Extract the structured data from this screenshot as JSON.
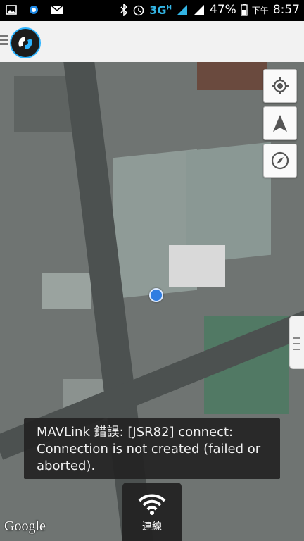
{
  "status_bar": {
    "network": "3G",
    "signal_sup": "H",
    "battery_percent": "47%",
    "ampm": "下午",
    "time": "8:57",
    "icons": [
      "gallery-icon",
      "app-icon",
      "mail-icon",
      "bluetooth-icon",
      "alarm-icon",
      "signal-icon",
      "battery-icon"
    ]
  },
  "action_bar": {
    "menu_icon": "hamburger-icon",
    "logo_icon": "app-logo-icon"
  },
  "map": {
    "controls": [
      "my-location-icon",
      "navigation-arrow-icon",
      "compass-icon"
    ],
    "side_tab_icon": "drawer-handle-icon",
    "attribution": "Google"
  },
  "toast": {
    "message": "MAVLink 錯誤: [JSR82] connect: Connection is not created (failed or aborted)."
  },
  "connect_button": {
    "icon": "wifi-icon",
    "label": "連線"
  },
  "colors": {
    "accent": "#2bb3ff",
    "location_dot": "#2f7de1",
    "toast_bg": "#232323"
  }
}
